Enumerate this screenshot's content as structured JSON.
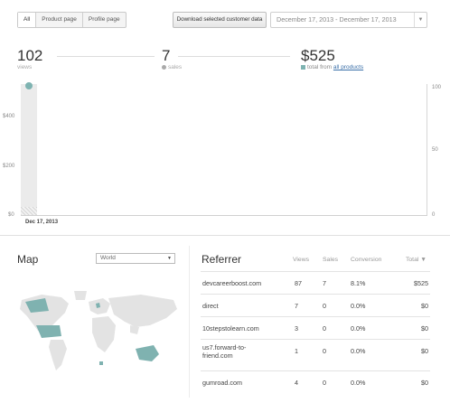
{
  "filters": {
    "tabs": [
      {
        "label": "All",
        "selected": true
      },
      {
        "label": "Product page",
        "selected": false
      },
      {
        "label": "Profile page",
        "selected": false
      }
    ],
    "download_label": "Download selected customer data",
    "date_range": "December 17, 2013 - December 17, 2013",
    "date_caret": "▼"
  },
  "stats": {
    "views": {
      "value": "102",
      "label": "views"
    },
    "sales": {
      "value": "7",
      "label": "sales"
    },
    "revenue": {
      "value": "$525",
      "label_prefix": "total from ",
      "link": "all products"
    }
  },
  "chart_data": {
    "type": "bar",
    "categories": [
      "Dec 17, 2013"
    ],
    "series": [
      {
        "axis": "left",
        "values": [
          30
        ]
      },
      {
        "axis": "right",
        "values": [
          100
        ]
      }
    ],
    "left_axis": {
      "ticks": [
        "$400",
        "$200",
        "$0"
      ],
      "ylim": [
        0,
        525
      ]
    },
    "right_axis": {
      "ticks": [
        "100",
        "50",
        "0"
      ],
      "ylim": [
        0,
        100
      ]
    },
    "x_tick_labels": [
      "Dec 17, 2013"
    ],
    "grid": false
  },
  "map": {
    "title": "Map",
    "region": "World",
    "caret": "▼",
    "colors": {
      "land": "#e3e3e3",
      "highlight": "#7fb2b0"
    }
  },
  "referrer": {
    "title": "Referrer",
    "columns": [
      "Views",
      "Sales",
      "Conversion",
      "Total ▼"
    ],
    "rows": [
      {
        "name": "devcareerboost.com",
        "views": "87",
        "sales": "7",
        "conversion": "8.1%",
        "total": "$525"
      },
      {
        "name": "direct",
        "views": "7",
        "sales": "0",
        "conversion": "0.0%",
        "total": "$0"
      },
      {
        "name": "10stepstolearn.com",
        "views": "3",
        "sales": "0",
        "conversion": "0.0%",
        "total": "$0"
      },
      {
        "name": "us7.forward-to-friend.com",
        "name_lines": [
          "us7.forward-to-",
          "friend.com"
        ],
        "views": "1",
        "sales": "0",
        "conversion": "0.0%",
        "total": "$0"
      },
      {
        "name": "gumroad.com",
        "views": "4",
        "sales": "0",
        "conversion": "0.0%",
        "total": "$0"
      }
    ]
  }
}
